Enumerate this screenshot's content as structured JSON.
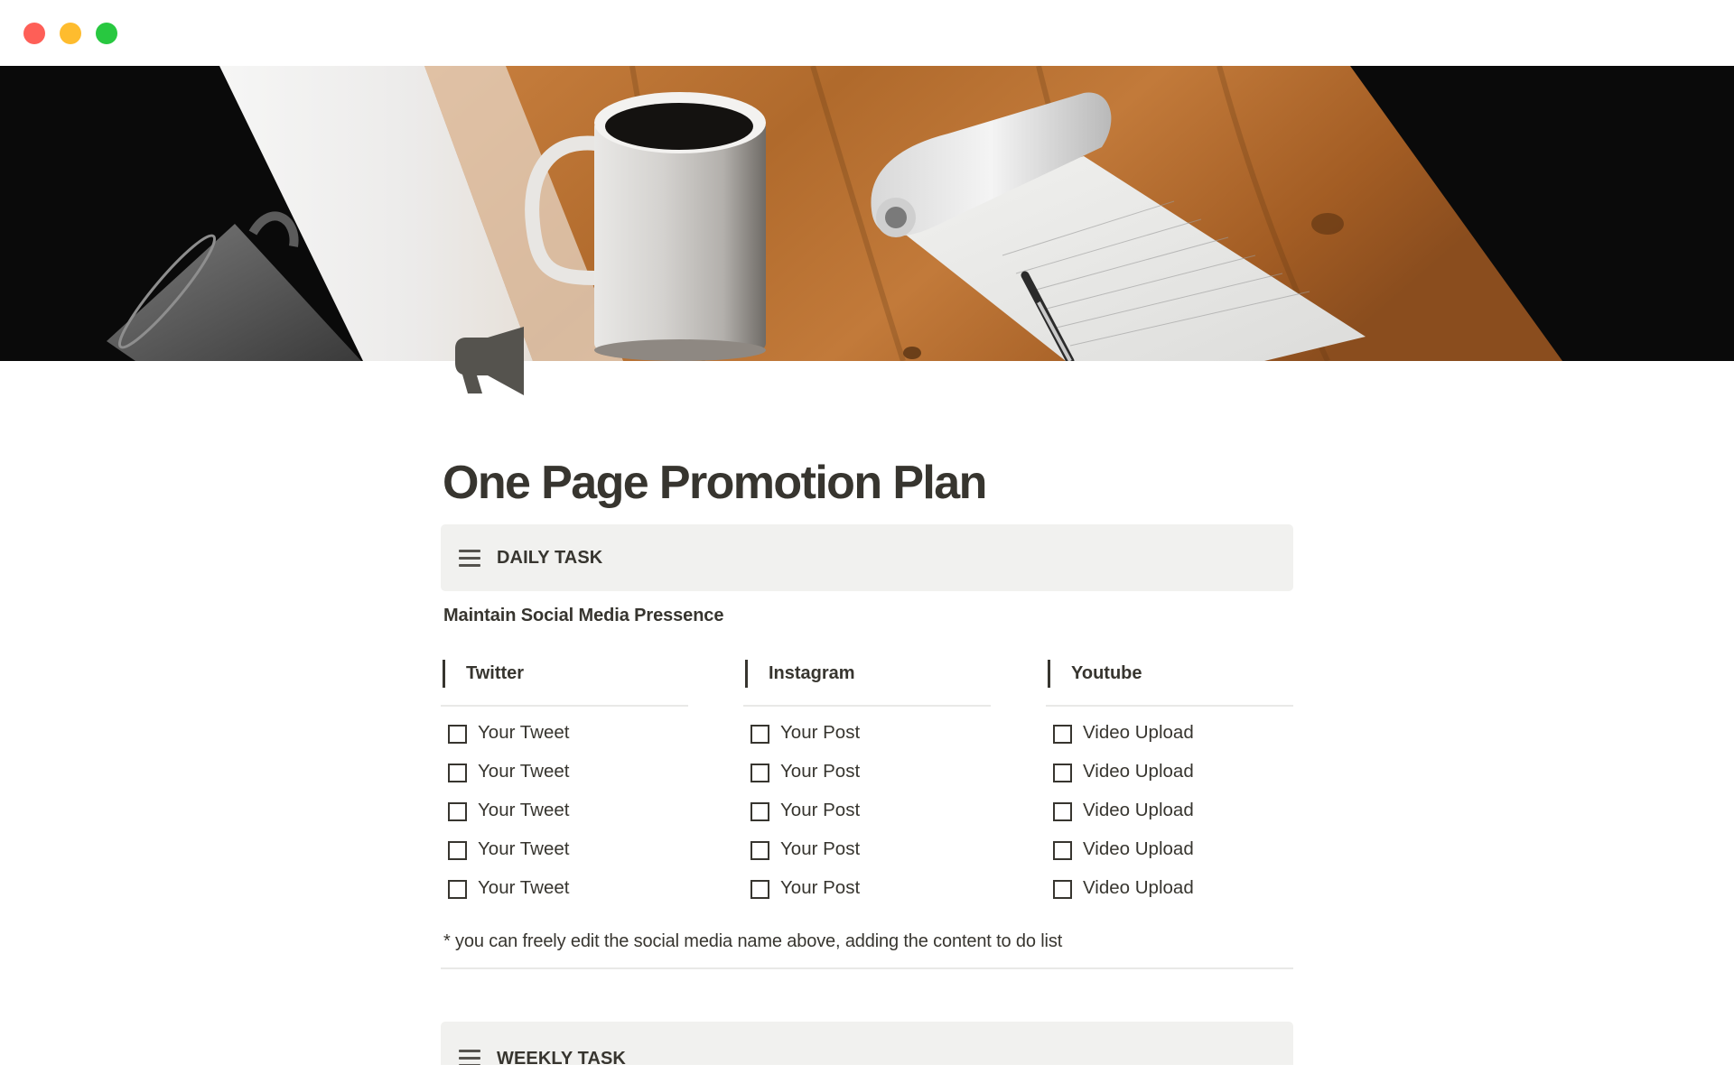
{
  "window": {
    "controls": [
      {
        "name": "close",
        "color": "#fe5f57"
      },
      {
        "name": "minimize",
        "color": "#febc2e"
      },
      {
        "name": "maximize",
        "color": "#28c840"
      }
    ]
  },
  "cover": {
    "description": "Coffee mugs and a notepad with a pen on a wooden table"
  },
  "page": {
    "icon": "megaphone-icon",
    "title": "One Page Promotion Plan"
  },
  "daily_task": {
    "icon": "hamburger-menu-icon",
    "label": "DAILY TASK",
    "subtitle": "Maintain Social Media Pressence",
    "columns": [
      {
        "heading": "Twitter",
        "todos": [
          {
            "text": "Your Tweet",
            "checked": false
          },
          {
            "text": "Your Tweet",
            "checked": false
          },
          {
            "text": "Your Tweet",
            "checked": false
          },
          {
            "text": "Your Tweet",
            "checked": false
          },
          {
            "text": "Your Tweet",
            "checked": false
          }
        ]
      },
      {
        "heading": "Instagram",
        "todos": [
          {
            "text": "Your Post",
            "checked": false
          },
          {
            "text": "Your Post",
            "checked": false
          },
          {
            "text": "Your Post",
            "checked": false
          },
          {
            "text": "Your Post",
            "checked": false
          },
          {
            "text": "Your Post",
            "checked": false
          }
        ]
      },
      {
        "heading": "Youtube",
        "todos": [
          {
            "text": "Video Upload",
            "checked": false
          },
          {
            "text": "Video Upload",
            "checked": false
          },
          {
            "text": "Video Upload",
            "checked": false
          },
          {
            "text": "Video Upload",
            "checked": false
          },
          {
            "text": "Video Upload",
            "checked": false
          }
        ]
      }
    ],
    "footnote": "* you can freely edit the social media name above, adding the content to do list"
  },
  "weekly_task": {
    "icon": "hamburger-menu-icon",
    "label": "WEEKLY TASK"
  },
  "colors": {
    "text": "#37352f",
    "callout_bg": "#f1f1ef",
    "divider": "#e9e9e7",
    "icon": "#55534e"
  }
}
